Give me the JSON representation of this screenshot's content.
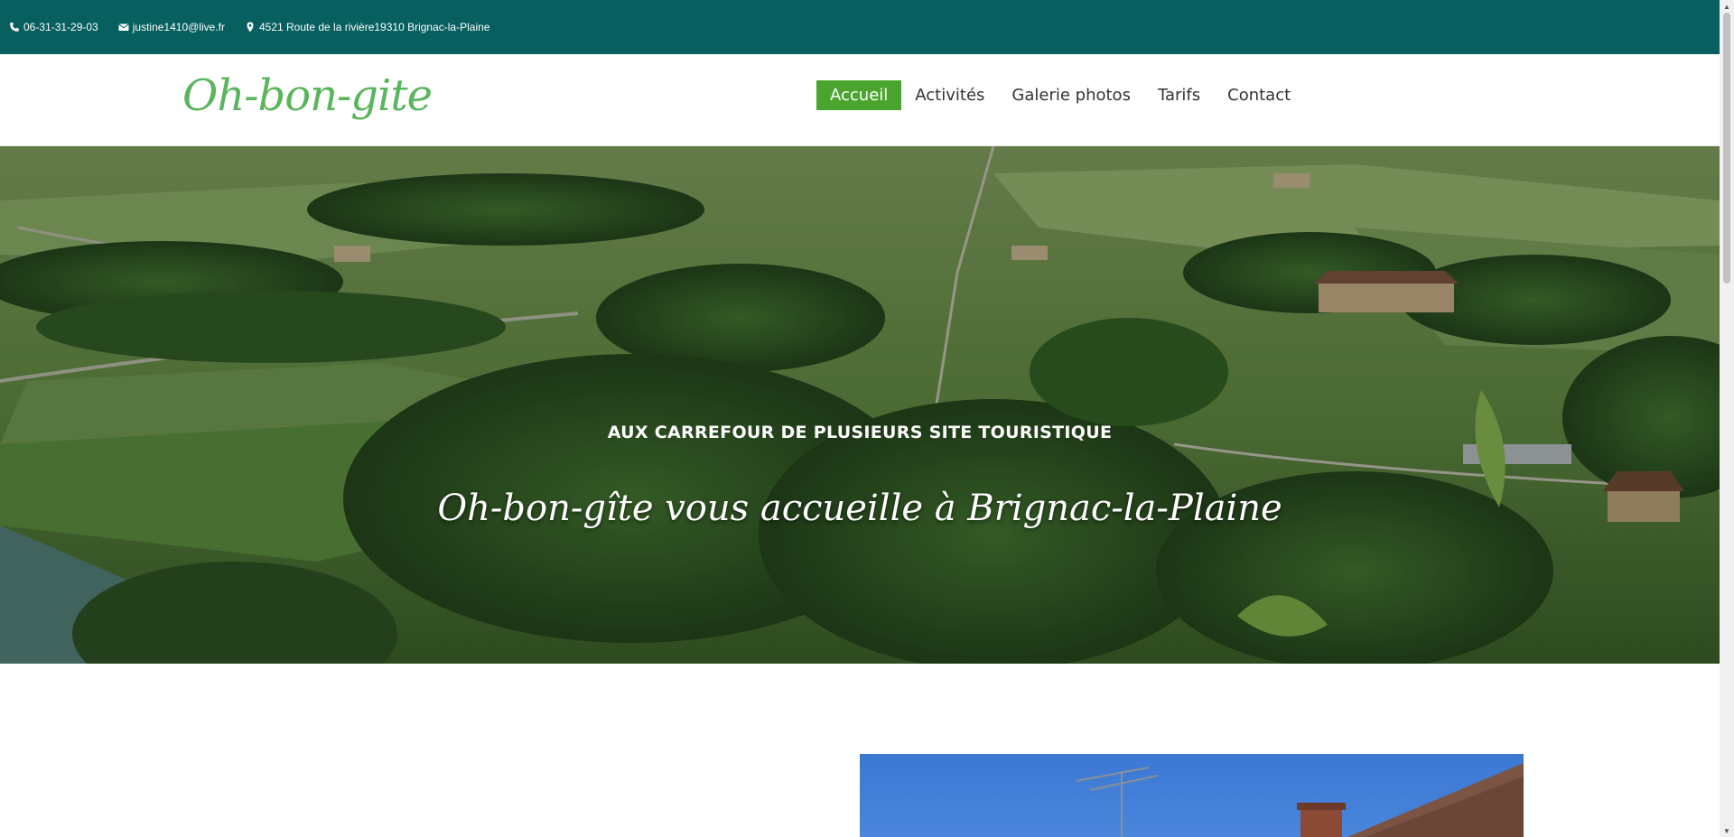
{
  "topbar": {
    "phone": "06-31-31-29-03",
    "email": "justine1410@live.fr",
    "address": "4521 Route de la rivière19310 Brignac-la-Plaine"
  },
  "header": {
    "logo": "Oh-bon-gite",
    "nav": [
      {
        "label": "Accueil",
        "active": true
      },
      {
        "label": "Activités"
      },
      {
        "label": "Galerie photos"
      },
      {
        "label": "Tarifs"
      },
      {
        "label": "Contact"
      }
    ]
  },
  "hero": {
    "subtitle": "AUX CARREFOUR DE PLUSIEURS SITE TOURISTIQUE",
    "title": "Oh-bon-gîte vous accueille à Brignac-la-Plaine"
  },
  "colors": {
    "topbar": "#075f5f",
    "accent": "#4aa52e",
    "logo": "#5ab55c"
  },
  "icons": {
    "phone": "phone-icon",
    "email": "envelope-icon",
    "address": "map-marker-icon"
  }
}
